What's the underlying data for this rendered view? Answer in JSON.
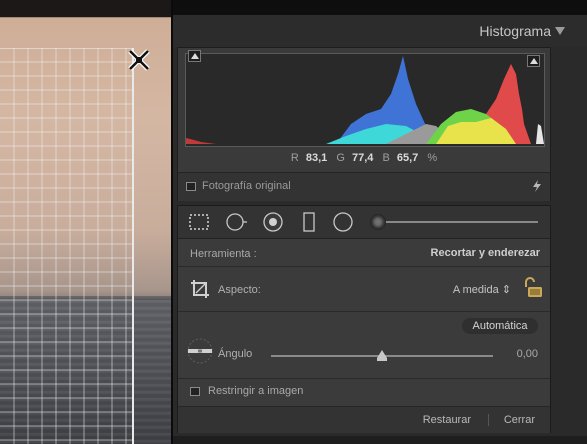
{
  "panel": {
    "histogram_title": "Histograma",
    "readout": {
      "r_label": "R",
      "r_value": "83,1",
      "g_label": "G",
      "g_value": "77,4",
      "b_label": "B",
      "b_value": "65,7",
      "unit": "%"
    },
    "original_photo_label": "Fotografía original",
    "tool": {
      "label": "Herramienta :",
      "value": "Recortar y enderezar"
    },
    "aspect": {
      "label": "Aspecto:",
      "value": "A medida ⇕"
    },
    "angle": {
      "auto_label": "Automática",
      "label": "Ángulo",
      "value": "0,00",
      "slider_level": 0.5
    },
    "restrict_label": "Restringir a imagen",
    "buttons": {
      "reset": "Restaurar",
      "close": "Cerrar"
    }
  },
  "colors": {
    "panel_bg": "#2a2a2a",
    "hist_red": "#e04a4a",
    "hist_green": "#6fd34a",
    "hist_blue": "#3f74d6",
    "hist_yellow": "#e8e34a",
    "hist_cyan": "#3fd8d8"
  },
  "icons": [
    "crop-close-handle-icon",
    "lightning-icon",
    "crop-overlay-icon",
    "spot-removal-icon",
    "red-eye-icon",
    "graduated-filter-icon",
    "radial-filter-icon",
    "adjustment-brush-icon",
    "crop-angle-icon",
    "lock-icon",
    "level-icon"
  ]
}
